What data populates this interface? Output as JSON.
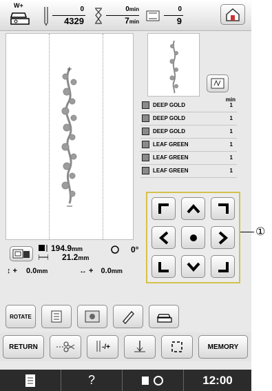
{
  "header": {
    "stitch_current": "0",
    "stitch_total": "4329",
    "time_current": "0",
    "time_total": "7",
    "time_unit": "min",
    "color_current": "0",
    "color_total": "9",
    "presser_foot_label": "W+"
  },
  "thread_list": {
    "min_label": "min",
    "items": [
      {
        "name": "DEEP GOLD",
        "minutes": "1"
      },
      {
        "name": "DEEP GOLD",
        "minutes": "1"
      },
      {
        "name": "DEEP GOLD",
        "minutes": "1"
      },
      {
        "name": "LEAF GREEN",
        "minutes": "1"
      },
      {
        "name": "LEAF GREEN",
        "minutes": "1"
      },
      {
        "name": "LEAF GREEN",
        "minutes": "1"
      }
    ]
  },
  "info": {
    "height_value": "194.9",
    "width_value": "21.2",
    "unit": "mm",
    "y_label": "0.0",
    "x_label": "0.0",
    "angle": "0°"
  },
  "toolbar": {
    "rotate_label": "ROTATE"
  },
  "bottom": {
    "return_label": "RETURN",
    "needle_label": "-/+",
    "memory_label": "MEMORY"
  },
  "status": {
    "help": "?",
    "time": "12:00"
  },
  "callout": "①"
}
